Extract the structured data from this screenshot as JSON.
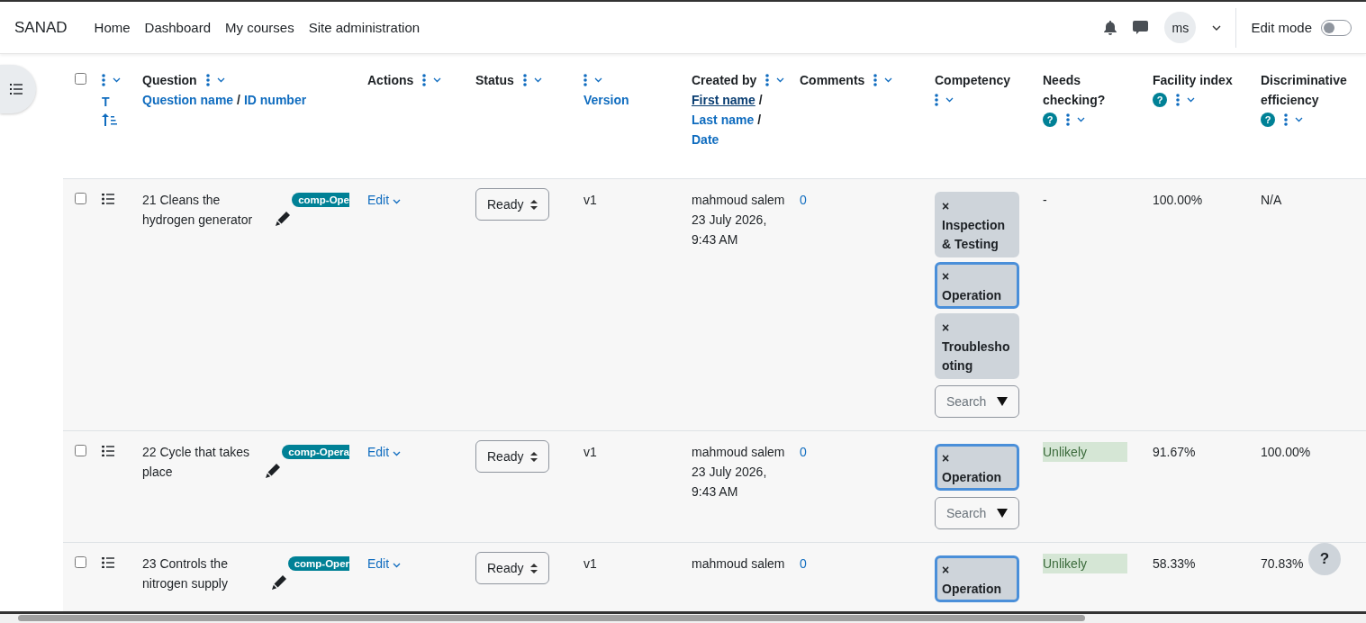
{
  "nav": {
    "brand": "SANAD",
    "links": [
      "Home",
      "Dashboard",
      "My courses",
      "Site administration"
    ],
    "user_initials": "ms",
    "edit_mode": {
      "label": "Edit mode",
      "on": false
    }
  },
  "table": {
    "select_all": {
      "checked": false
    },
    "columns": [
      {
        "kind": "select"
      },
      {
        "kind": "sort",
        "links": [
          {
            "label": "T",
            "hovered": false
          }
        ]
      },
      {
        "kind": "heading",
        "title": "Question",
        "separator": "/",
        "links": [
          {
            "label": "Question name",
            "hovered": false
          },
          {
            "label": "ID number",
            "hovered": false
          }
        ]
      },
      {
        "kind": "heading",
        "title": "Actions"
      },
      {
        "kind": "heading",
        "title": "Status"
      },
      {
        "kind": "heading",
        "links": [
          {
            "label": "Version",
            "hovered": false
          }
        ]
      },
      {
        "kind": "heading",
        "title": "Created by",
        "separator": "/",
        "links": [
          {
            "label": "First name",
            "hovered": true
          },
          {
            "label": "Last name",
            "hovered": false
          },
          {
            "label": "Date",
            "hovered": false
          }
        ]
      },
      {
        "kind": "heading",
        "title": "Comments"
      },
      {
        "kind": "heading",
        "title": "Competency"
      },
      {
        "kind": "heading",
        "title": "Needs checking?",
        "help": "?"
      },
      {
        "kind": "heading",
        "title": "Facility index",
        "help": "?"
      },
      {
        "kind": "heading",
        "title": "Discriminative efficiency",
        "help": "?"
      }
    ],
    "rows": [
      {
        "selected": false,
        "name": "21 Cleans the hydrogen generator",
        "tag": "comp-Ope",
        "action": "Edit",
        "status": "Ready",
        "version": "v1",
        "creator": "mahmoud salem",
        "date": "23 July 2026, 9:43 AM",
        "comments": "0",
        "competencies": [
          {
            "remove": "×",
            "label": "Inspection & Testing",
            "focused": false
          },
          {
            "remove": "×",
            "label": "Operation",
            "focused": true
          },
          {
            "remove": "×",
            "label": "Troubleshooting",
            "focused": false
          }
        ],
        "search": "Search",
        "needs_checking": {
          "text": "-",
          "kind": "none"
        },
        "facility": "100.00%",
        "discrimination": "N/A"
      },
      {
        "selected": false,
        "name": "22 Cycle that takes place",
        "tag": "comp-Opera",
        "action": "Edit",
        "status": "Ready",
        "version": "v1",
        "creator": "mahmoud salem",
        "date": "23 July 2026, 9:43 AM",
        "comments": "0",
        "competencies": [
          {
            "remove": "×",
            "label": "Operation",
            "focused": true
          }
        ],
        "search": "Search",
        "needs_checking": {
          "text": "Unlikely",
          "kind": "unlikely"
        },
        "facility": "91.67%",
        "discrimination": "100.00%"
      },
      {
        "selected": false,
        "name": "23 Controls the nitrogen supply",
        "tag": "comp-Oper",
        "action": "Edit",
        "status": "Ready",
        "version": "v1",
        "creator": "mahmoud salem",
        "comments": "0",
        "competencies": [
          {
            "remove": "×",
            "label": "Operation",
            "focused": true
          }
        ],
        "needs_checking": {
          "text": "Unlikely",
          "kind": "unlikely"
        },
        "facility": "58.33%",
        "discrimination": "70.83%"
      }
    ]
  },
  "help_button": "?"
}
